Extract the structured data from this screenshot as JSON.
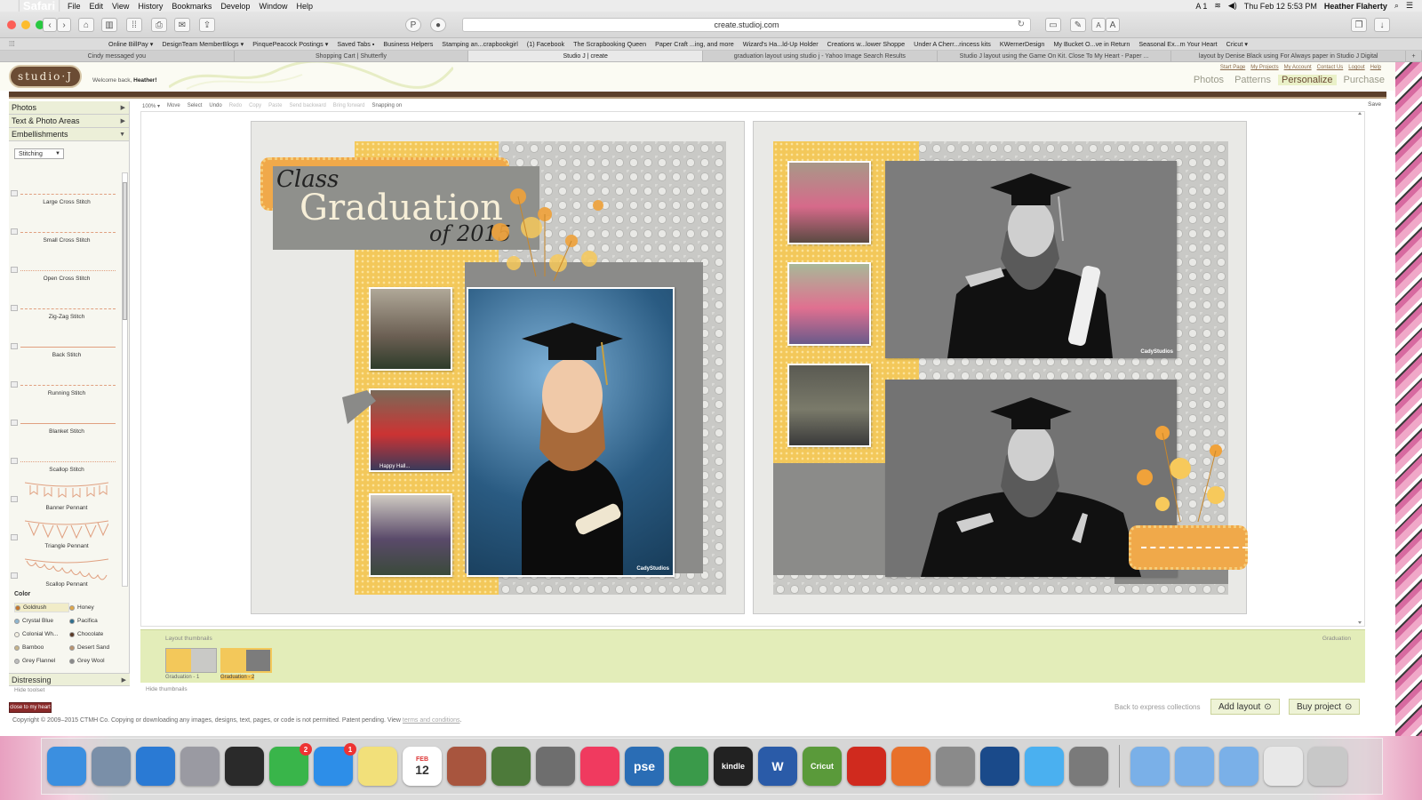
{
  "menubar": {
    "items": [
      "Safari",
      "File",
      "Edit",
      "View",
      "History",
      "Bookmarks",
      "Develop",
      "Window",
      "Help"
    ],
    "status_user": "Heather Flaherty",
    "status_time": "Thu Feb 12  5:53 PM",
    "status_ai": "A 1"
  },
  "browser": {
    "url": "create.studioj.com",
    "font_small": "A",
    "font_large": "A",
    "bookmarks": [
      "Online BillPay ▾",
      "DesignTeam MemberBlogs ▾",
      "PinquePeacock Postings ▾",
      "Saved Tabs ▪",
      "Business Helpers",
      "Stamping an...crapbookgirl",
      "(1) Facebook",
      "The Scrapbooking Queen",
      "Paper Craft ...ing, and more",
      "Wizard's Ha...ld-Up Holder",
      "Creations w...lower Shoppe",
      "Under A Cherr...rincess kits",
      "KWernerDesign",
      "My Bucket O...ve in Return",
      "Seasonal Ex...m Your Heart",
      "Cricut ▾"
    ],
    "tabs": [
      "Cindy messaged you",
      "Shopping Cart | Shutterfly",
      "Studio J | create",
      "graduation layout using studio j - Yahoo Image Search Results",
      "Studio J layout using the Game On Kit. Close To My Heart - Paper ...",
      "layout by Denise Black using For Always paper in Studio J Digital"
    ],
    "active_tab_index": 2
  },
  "site": {
    "logo": "studio·J",
    "welcome_prefix": "Welcome back, ",
    "welcome_name": "Heather!",
    "top_links": [
      "Start Page",
      "My Projects",
      "My Account",
      "Contact Us",
      "Logout",
      "Help"
    ],
    "nav": [
      "Photos",
      "Patterns",
      "Personalize",
      "Purchase"
    ],
    "nav_active": "Personalize"
  },
  "left_panel": {
    "sections": [
      "Photos",
      "Text & Photo Areas",
      "Embellishments"
    ],
    "dropdown_value": "Stitching",
    "stitches": [
      "Large Cross Stitch",
      "Small Cross Stitch",
      "Open Cross Stitch",
      "Zig-Zag Stitch",
      "Back Stitch",
      "Running Stitch",
      "Blanket Stitch",
      "Scallop Stitch",
      "Banner Pennant",
      "Triangle Pennant",
      "Scallop Pennant"
    ],
    "color_title": "Color",
    "colors": [
      {
        "name": "Goldrush",
        "hex": "#c7762a",
        "selected": true
      },
      {
        "name": "Honey",
        "hex": "#e0a84a"
      },
      {
        "name": "Crystal Blue",
        "hex": "#8fb6cf"
      },
      {
        "name": "Pacifica",
        "hex": "#2f6f8f"
      },
      {
        "name": "Colonial Wh...",
        "hex": "#f4f0e2"
      },
      {
        "name": "Chocolate",
        "hex": "#5a3a26"
      },
      {
        "name": "Bamboo",
        "hex": "#c8b48a"
      },
      {
        "name": "Desert Sand",
        "hex": "#b99470"
      },
      {
        "name": "Grey Flannel",
        "hex": "#bdbdbd"
      },
      {
        "name": "Grey Wool",
        "hex": "#8a8a8a"
      }
    ],
    "distressing": "Distressing",
    "hide_toolset": "Hide toolset"
  },
  "editor_toolbar": {
    "zoom": "100% ▾",
    "move": "Move",
    "select": "Select",
    "undo": "Undo",
    "redo": "Redo",
    "copy": "Copy",
    "paste": "Paste",
    "send_backward": "Send backward",
    "bring_forward": "Bring forward",
    "snapping": "Snapping on",
    "save": "Save"
  },
  "canvas": {
    "title_line1": "Class",
    "title_line2": "Graduation",
    "title_line3": "of 2015",
    "watermark": "CadyStudios",
    "caption_small": "Happy Hall..."
  },
  "thumbnails": {
    "title": "Layout thumbnails",
    "right_label": "Graduation",
    "items": [
      {
        "label": "Graduation - 1",
        "selected": false
      },
      {
        "label": "Graduation - 2",
        "selected": true
      }
    ],
    "hide": "Hide thumbnails"
  },
  "actions": {
    "brand": "close to my heart",
    "back": "Back to express collections",
    "add_layout": "Add layout",
    "buy_project": "Buy project"
  },
  "footer": {
    "copyright": "Copyright © 2009–2015 CTMH Co. Copying or downloading any images, designs, text, pages, or code is not permitted. Patent pending. View ",
    "terms": "terms and conditions",
    "period": "."
  },
  "dock": {
    "apps": [
      {
        "name": "finder-icon",
        "color": "#3b8fe0",
        "label": ""
      },
      {
        "name": "preview-icon",
        "color": "#7a8fa8",
        "label": ""
      },
      {
        "name": "safari-icon",
        "color": "#2a7ad4",
        "label": ""
      },
      {
        "name": "launchpad-icon",
        "color": "#9a9aa2",
        "label": ""
      },
      {
        "name": "photo-booth-icon",
        "color": "#2a2a2a",
        "label": ""
      },
      {
        "name": "facetime-icon",
        "color": "#39b54a",
        "label": "",
        "badge": "2"
      },
      {
        "name": "app-store-icon",
        "color": "#2d8ee8",
        "label": "",
        "badge": "1"
      },
      {
        "name": "notes-icon",
        "color": "#f2e07a",
        "label": ""
      },
      {
        "name": "calendar-icon",
        "color": "#ffffff",
        "label": "12",
        "sub": "FEB"
      },
      {
        "name": "photo-stack-icon",
        "color": "#a8553e",
        "label": ""
      },
      {
        "name": "iphoto-icon",
        "color": "#4d7a3a",
        "label": ""
      },
      {
        "name": "system-prefs-icon",
        "color": "#6e6e6e",
        "label": ""
      },
      {
        "name": "itunes-icon",
        "color": "#f03a5f",
        "label": ""
      },
      {
        "name": "photoshop-elements-icon",
        "color": "#2a6db5",
        "label": "pse"
      },
      {
        "name": "sims-icon",
        "color": "#3a9a4a",
        "label": ""
      },
      {
        "name": "kindle-icon",
        "color": "#222222",
        "label": "kindle"
      },
      {
        "name": "word-icon",
        "color": "#2a5ba8",
        "label": "W"
      },
      {
        "name": "cricut-icon",
        "color": "#5a9a3a",
        "label": "Cricut"
      },
      {
        "name": "acrobat-icon",
        "color": "#d02a1e",
        "label": ""
      },
      {
        "name": "firefox-icon",
        "color": "#e8702a",
        "label": ""
      },
      {
        "name": "calculator-icon",
        "color": "#8a8a8a",
        "label": ""
      },
      {
        "name": "xcode-icon",
        "color": "#1a4a8a",
        "label": ""
      },
      {
        "name": "messages-icon",
        "color": "#4ab0f0",
        "label": ""
      },
      {
        "name": "printer-icon",
        "color": "#7a7a7a",
        "label": ""
      },
      {
        "name": "applications-folder-icon",
        "color": "#7ab0e8",
        "label": ""
      },
      {
        "name": "downloads-folder-icon",
        "color": "#7ab0e8",
        "label": ""
      },
      {
        "name": "documents-folder-icon",
        "color": "#7ab0e8",
        "label": ""
      },
      {
        "name": "document-stack-icon",
        "color": "#e8e8e8",
        "label": ""
      },
      {
        "name": "trash-icon",
        "color": "#c8c8c8",
        "label": ""
      }
    ]
  }
}
